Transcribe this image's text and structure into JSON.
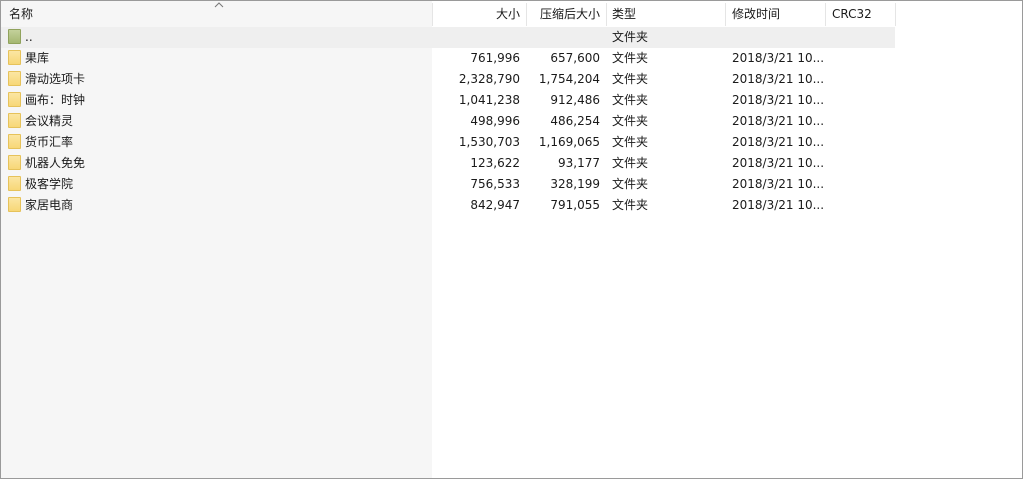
{
  "columns": {
    "name": "名称",
    "size": "大小",
    "packed": "压缩后大小",
    "type": "类型",
    "modified": "修改时间",
    "crc": "CRC32"
  },
  "sort": {
    "column": "name",
    "direction": "ascending",
    "icon": "sort-up-chevron-icon"
  },
  "colors": {
    "folder": "#f7d777",
    "parent_folder": "#a5b771",
    "selected_row": "#efefef",
    "name_column_shade": "#f6f6f6"
  },
  "rows": [
    {
      "name": "..",
      "size": "",
      "packed": "",
      "type": "文件夹",
      "modified": "",
      "icon": "parent-folder-icon",
      "selected": true
    },
    {
      "name": "果库",
      "size": "761,996",
      "packed": "657,600",
      "type": "文件夹",
      "modified": "2018/3/21 10...",
      "icon": "folder-icon"
    },
    {
      "name": "滑动选项卡",
      "size": "2,328,790",
      "packed": "1,754,204",
      "type": "文件夹",
      "modified": "2018/3/21 10...",
      "icon": "folder-icon"
    },
    {
      "name": "画布：时钟",
      "size": "1,041,238",
      "packed": "912,486",
      "type": "文件夹",
      "modified": "2018/3/21 10...",
      "icon": "folder-icon"
    },
    {
      "name": "会议精灵",
      "size": "498,996",
      "packed": "486,254",
      "type": "文件夹",
      "modified": "2018/3/21 10...",
      "icon": "folder-icon"
    },
    {
      "name": "货币汇率",
      "size": "1,530,703",
      "packed": "1,169,065",
      "type": "文件夹",
      "modified": "2018/3/21 10...",
      "icon": "folder-icon"
    },
    {
      "name": "机器人免免",
      "size": "123,622",
      "packed": "93,177",
      "type": "文件夹",
      "modified": "2018/3/21 10...",
      "icon": "folder-icon"
    },
    {
      "name": "极客学院",
      "size": "756,533",
      "packed": "328,199",
      "type": "文件夹",
      "modified": "2018/3/21 10...",
      "icon": "folder-icon"
    },
    {
      "name": "家居电商",
      "size": "842,947",
      "packed": "791,055",
      "type": "文件夹",
      "modified": "2018/3/21 10...",
      "icon": "folder-icon"
    }
  ]
}
